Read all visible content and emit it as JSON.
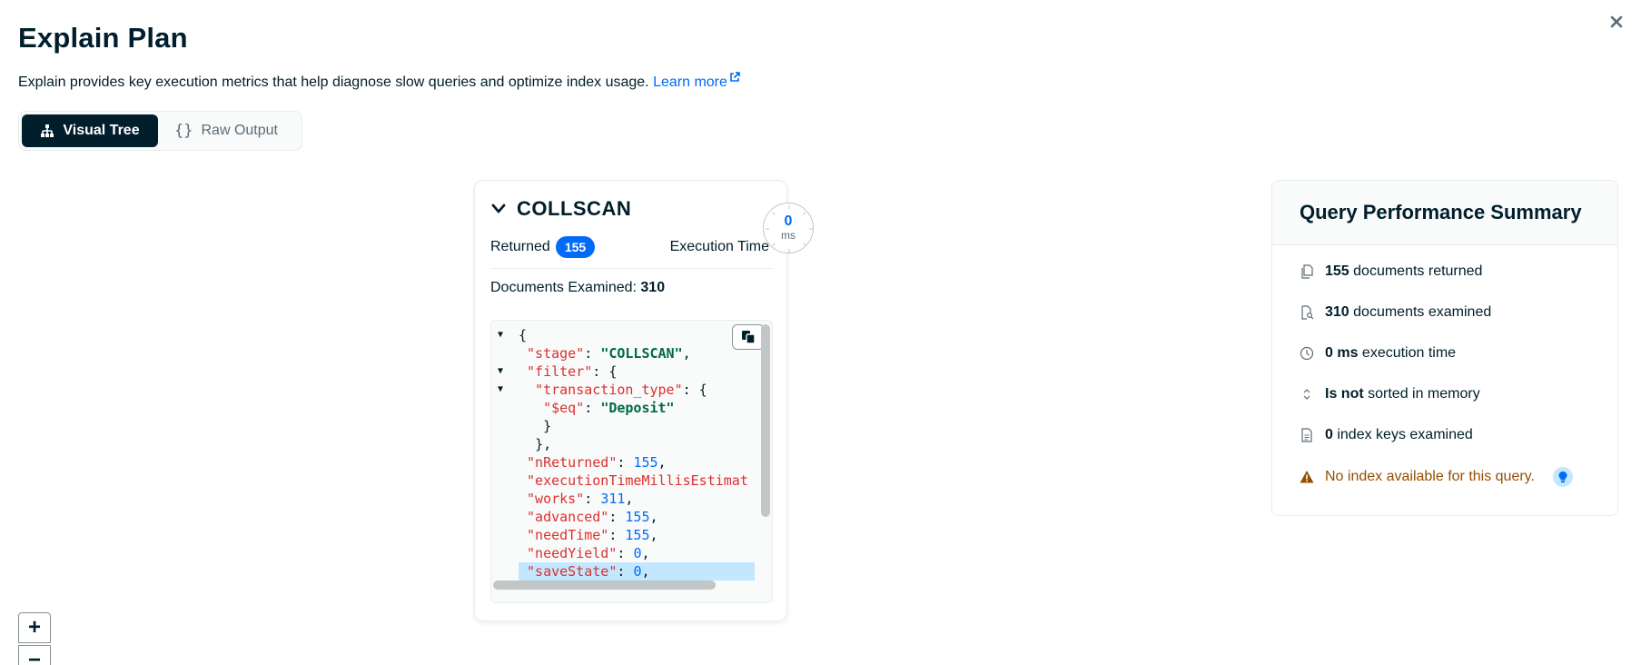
{
  "page": {
    "title": "Explain Plan",
    "description": "Explain provides key execution metrics that help diagnose slow queries and optimize index usage.",
    "learn_more": "Learn more",
    "close_icon": "close-icon"
  },
  "view_toggle": {
    "visual_tree": "Visual Tree",
    "raw_output": "Raw Output",
    "selected": "Visual Tree"
  },
  "stage_card": {
    "title": "COLLSCAN",
    "returned_label": "Returned",
    "returned_value": "155",
    "execution_time_label": "Execution Time",
    "execution_time_value": "0",
    "execution_time_unit": "ms",
    "docs_examined_label": "Documents Examined: ",
    "docs_examined_value": "310",
    "code_lines": [
      {
        "indent": "",
        "key": "",
        "punct": "{",
        "value": "",
        "toggle": true
      },
      {
        "indent": " ",
        "key": "\"stage\"",
        "punct": ": ",
        "value": "\"COLLSCAN\"",
        "vtype": "s",
        "tail": ",",
        "toggle": false
      },
      {
        "indent": " ",
        "key": "\"filter\"",
        "punct": ": {",
        "value": "",
        "toggle": true
      },
      {
        "indent": "  ",
        "key": "\"transaction_type\"",
        "punct": ": {",
        "value": "",
        "toggle": true
      },
      {
        "indent": "   ",
        "key": "\"$eq\"",
        "punct": ": ",
        "value": "\"Deposit\"",
        "vtype": "s",
        "tail": "",
        "toggle": false
      },
      {
        "indent": "   ",
        "key": "",
        "punct": "}",
        "value": "",
        "toggle": false
      },
      {
        "indent": "  ",
        "key": "",
        "punct": "},",
        "value": "",
        "toggle": false
      },
      {
        "indent": " ",
        "key": "\"nReturned\"",
        "punct": ": ",
        "value": "155",
        "vtype": "n",
        "tail": ",",
        "toggle": false
      },
      {
        "indent": " ",
        "key": "\"executionTimeMillisEstimat",
        "punct": "",
        "value": "",
        "toggle": false
      },
      {
        "indent": " ",
        "key": "\"works\"",
        "punct": ": ",
        "value": "311",
        "vtype": "n",
        "tail": ",",
        "toggle": false
      },
      {
        "indent": " ",
        "key": "\"advanced\"",
        "punct": ": ",
        "value": "155",
        "vtype": "n",
        "tail": ",",
        "toggle": false
      },
      {
        "indent": " ",
        "key": "\"needTime\"",
        "punct": ": ",
        "value": "155",
        "vtype": "n",
        "tail": ",",
        "toggle": false
      },
      {
        "indent": " ",
        "key": "\"needYield\"",
        "punct": ": ",
        "value": "0",
        "vtype": "n",
        "tail": ",",
        "toggle": false
      },
      {
        "indent": " ",
        "key": "\"saveState\"",
        "punct": ": ",
        "value": "0",
        "vtype": "n",
        "tail": ",",
        "toggle": false,
        "selected": true
      }
    ]
  },
  "summary": {
    "title": "Query Performance Summary",
    "items": [
      {
        "icon": "documents-icon",
        "strong": "155",
        "text": " documents returned"
      },
      {
        "icon": "document-search-icon",
        "strong": "310",
        "text": " documents examined"
      },
      {
        "icon": "clock-icon",
        "strong": "0 ms",
        "text": " execution time"
      },
      {
        "icon": "sort-icon",
        "strong": "Is not",
        "text": " sorted in memory"
      },
      {
        "icon": "index-document-icon",
        "strong": "0",
        "text": " index keys examined"
      }
    ],
    "warning": "No index available for this query.",
    "warning_icon": "warning-icon",
    "hint_icon": "lightbulb-icon"
  },
  "zoom": {
    "in": "+",
    "out": "−"
  },
  "colors": {
    "accent": "#016bf8",
    "dark": "#001e2b",
    "warning": "#944f01",
    "json_key": "#db3030",
    "json_string": "#00684a"
  }
}
